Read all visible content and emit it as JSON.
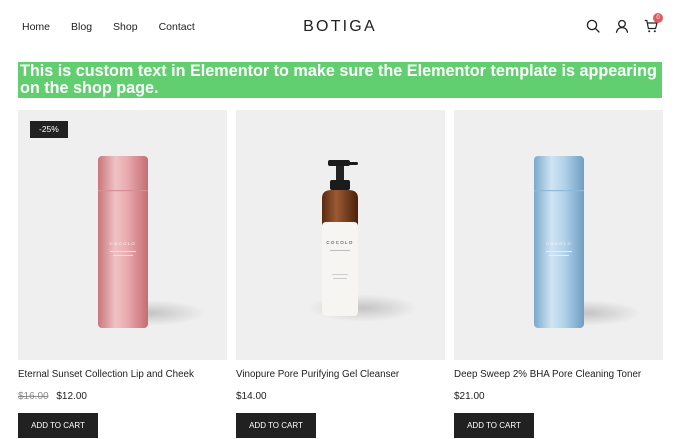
{
  "nav": {
    "items": [
      {
        "label": "Home"
      },
      {
        "label": "Blog"
      },
      {
        "label": "Shop"
      },
      {
        "label": "Contact"
      }
    ]
  },
  "logo": "BOTIGA",
  "header_icons": {
    "search": "search-icon",
    "account": "user-icon",
    "cart": "cart-icon",
    "cart_count": "0"
  },
  "banner": {
    "text": "This is custom text in Elementor to make sure the Elementor template is appearing on the shop page.",
    "color": "#61ce70"
  },
  "products": [
    {
      "title": "Eternal Sunset Collection Lip and Cheek",
      "badge": "-25%",
      "old_price": "$16.00",
      "price": "$12.00",
      "button": "ADD TO CART",
      "bottle_label": "COCOLO",
      "bottle_color": "#e7a7aa"
    },
    {
      "title": "Vinopure Pore Purifying Gel Cleanser",
      "price": "$14.00",
      "button": "ADD TO CART",
      "bottle_label": "COCOLO",
      "bottle_color": "#8a4a2a"
    },
    {
      "title": "Deep Sweep 2% BHA Pore Cleaning Toner",
      "price": "$21.00",
      "button": "ADD TO CART",
      "bottle_label": "COCOLO",
      "bottle_color": "#a9cde6"
    }
  ]
}
